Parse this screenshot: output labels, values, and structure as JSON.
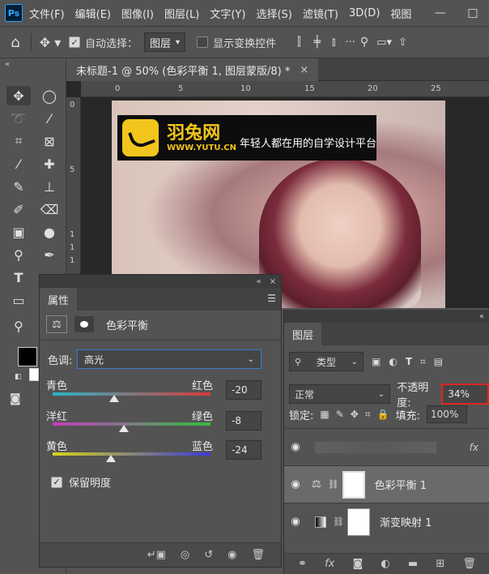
{
  "menubar": {
    "logo": "Ps",
    "items": [
      "文件(F)",
      "编辑(E)",
      "图像(I)",
      "图层(L)",
      "文字(Y)",
      "选择(S)",
      "滤镜(T)",
      "3D(D)",
      "视图"
    ],
    "min": "—",
    "max": "□"
  },
  "options": {
    "auto_select_label": "自动选择：",
    "auto_select_value": "图层",
    "show_transform_label": "显示变换控件"
  },
  "document": {
    "tab_title": "未标题-1 @ 50% (色彩平衡 1, 图层蒙版/8) *",
    "close": "×",
    "ruler_h": [
      "0",
      "5",
      "10",
      "15",
      "20",
      "25"
    ],
    "ruler_v": [
      "0",
      "5",
      "1",
      "1",
      "1"
    ]
  },
  "watermark": {
    "name": "羽兔网",
    "url": "WWW.YUTU.CN",
    "slogan": "年轻人都在用的自学设计平台"
  },
  "properties": {
    "collapse": "«",
    "close": "×",
    "tab": "属性",
    "adjustment": "色彩平衡",
    "tone_label": "色调:",
    "tone_value": "高光",
    "sliders": [
      {
        "left": "青色",
        "right": "红色",
        "value": "-20",
        "pos": 0.4
      },
      {
        "left": "洋红",
        "right": "绿色",
        "value": "-8",
        "pos": 0.46
      },
      {
        "left": "黄色",
        "right": "蓝色",
        "value": "-24",
        "pos": 0.37
      }
    ],
    "preserve_label": "保留明度"
  },
  "layers": {
    "tab": "图层",
    "filter_value": "类型",
    "blend_mode": "正常",
    "opacity_label": "不透明度:",
    "opacity_value": "34%",
    "lock_label": "锁定:",
    "fill_label": "填充:",
    "fill_value": "100%",
    "items": [
      {
        "name": "色彩平衡 1",
        "icon": "balance-icon"
      },
      {
        "name": "渐变映射 1",
        "icon": "gradient-map-icon"
      }
    ],
    "fx": "fx"
  },
  "colors": {
    "highlight": "#e0261f",
    "accent": "#f2c51c",
    "selection": "#3b78d6"
  }
}
